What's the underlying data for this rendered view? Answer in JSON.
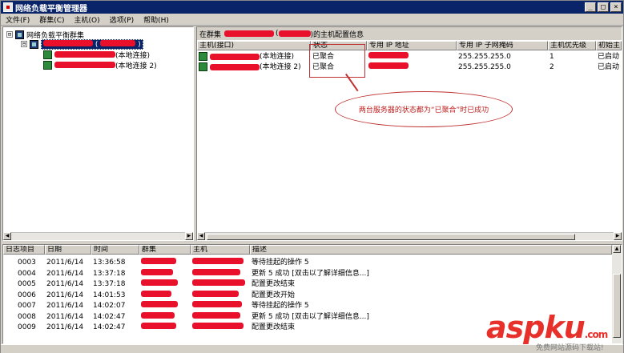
{
  "window": {
    "title": "网络负载平衡管理器",
    "minimize_glyph": "_",
    "maximize_glyph": "□",
    "close_glyph": "×"
  },
  "menu": [
    "文件(F)",
    "群集(C)",
    "主机(O)",
    "选项(P)",
    "帮助(H)"
  ],
  "tree": {
    "root_label": "网络负载平衡群集",
    "cluster_suffix": "(",
    "cluster_close": ")",
    "hosts": [
      {
        "suffix": "(本地连接)"
      },
      {
        "suffix": "(本地连接 2)"
      }
    ],
    "expanded_glyph": "⊟"
  },
  "config_panel": {
    "header_prefix": "在群集",
    "header_middle": "(",
    "header_suffix": ")的主机配置信息",
    "columns": [
      "主机(接口)",
      "状态",
      "专用 IP 地址",
      "专用 IP 子网掩码",
      "主机优先级",
      "初始主"
    ],
    "rows": [
      {
        "host_suffix": "(本地连接)",
        "status": "已聚合",
        "mask": "255.255.255.0",
        "priority": "1",
        "initial": "已启动"
      },
      {
        "host_suffix": "(本地连接 2)",
        "status": "已聚合",
        "mask": "255.255.255.0",
        "priority": "2",
        "initial": "已启动"
      }
    ]
  },
  "annotation": {
    "callout_text": "两台服务器的状态都为“已聚合”时已成功",
    "border_color": "#c03030"
  },
  "log_panel": {
    "columns": [
      "日志项目",
      "日期",
      "时间",
      "群集",
      "主机",
      "描述"
    ],
    "rows": [
      {
        "id": "0003",
        "date": "2011/6/14",
        "time": "13:36:58",
        "desc": "等待挂起的操作 5"
      },
      {
        "id": "0004",
        "date": "2011/6/14",
        "time": "13:37:18",
        "desc": "更新 5 成功 [双击以了解详细信息...]"
      },
      {
        "id": "0005",
        "date": "2011/6/14",
        "time": "13:37:18",
        "desc": "配置更改结束"
      },
      {
        "id": "0006",
        "date": "2011/6/14",
        "time": "14:01:53",
        "desc": "配置更改开始"
      },
      {
        "id": "0007",
        "date": "2011/6/14",
        "time": "14:02:07",
        "desc": "等待挂起的操作 5"
      },
      {
        "id": "0008",
        "date": "2011/6/14",
        "time": "14:02:47",
        "desc": "更新 5 成功 [双击以了解详细信息...]"
      },
      {
        "id": "0009",
        "date": "2011/6/14",
        "time": "14:02:47",
        "desc": "配置更改结束"
      }
    ]
  },
  "watermark": {
    "logo_text": "aspku",
    "logo_suffix": ".com",
    "subtitle": "免费网站源码下载站!",
    "color": "#e8302a"
  },
  "colors": {
    "titlebar": "#0a246a",
    "redaction": "#e8102a",
    "chrome": "#d4d0c8"
  }
}
